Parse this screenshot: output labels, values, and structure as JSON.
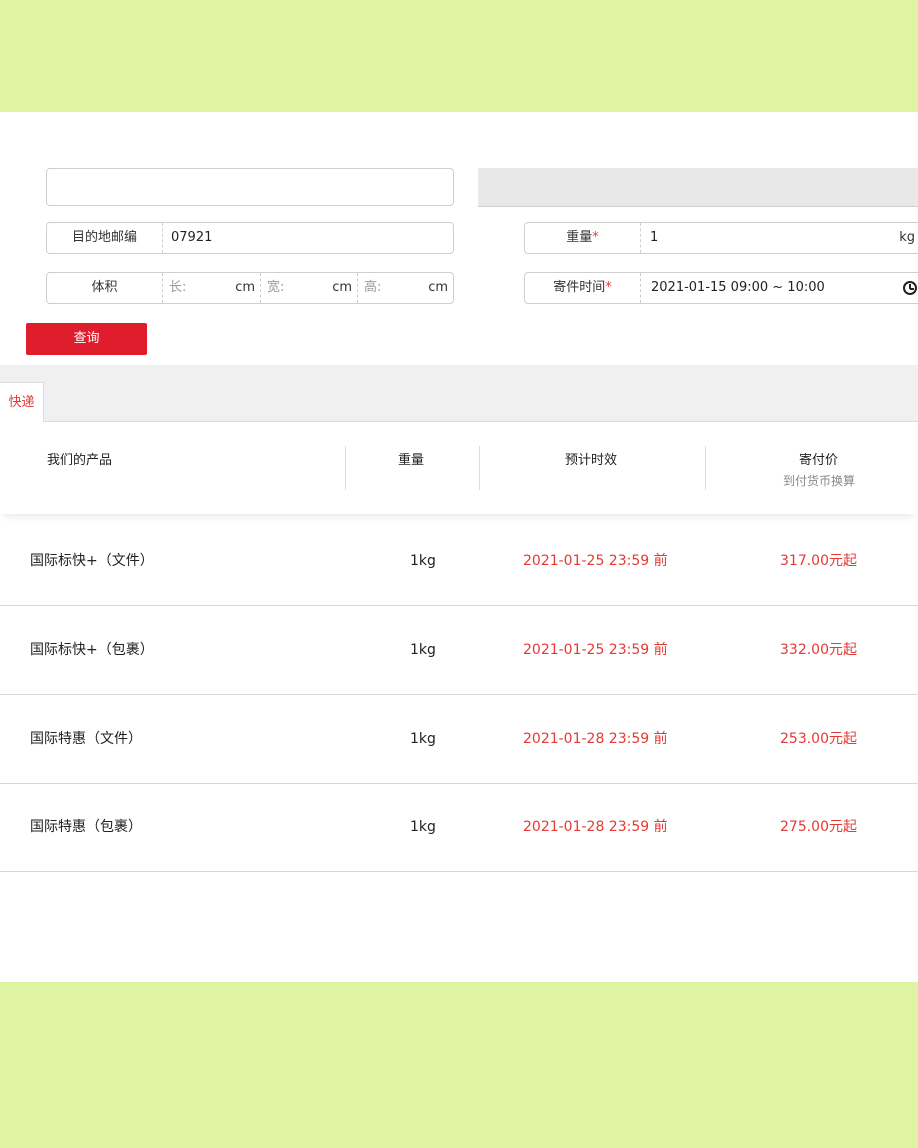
{
  "form": {
    "destination_zip_label": "目的地邮编",
    "destination_zip_value": "07921",
    "weight_label": "重量",
    "weight_value": "1",
    "weight_unit": "kg",
    "volume_label": "体积",
    "length_placeholder": "长:",
    "width_placeholder": "宽:",
    "height_placeholder": "高:",
    "dimension_unit": "cm",
    "ship_time_label": "寄件时间",
    "ship_time_value": "2021-01-15 09:00 ~ 10:00",
    "required_mark": "*",
    "query_button": "查询"
  },
  "tabs": [
    {
      "label": "快递",
      "active": true
    }
  ],
  "table": {
    "headers": {
      "product": "我们的产品",
      "weight": "重量",
      "eta": "预计时效",
      "price": "寄付价",
      "price_sub": "到付货币换算"
    },
    "rows": [
      {
        "product": "国际标快+（文件）",
        "weight": "1kg",
        "eta": "2021-01-25 23:59 前",
        "price": "317.00元起"
      },
      {
        "product": "国际标快+（包裹）",
        "weight": "1kg",
        "eta": "2021-01-25 23:59 前",
        "price": "332.00元起"
      },
      {
        "product": "国际特惠（文件）",
        "weight": "1kg",
        "eta": "2021-01-28 23:59 前",
        "price": "253.00元起"
      },
      {
        "product": "国际特惠（包裹）",
        "weight": "1kg",
        "eta": "2021-01-28 23:59 前",
        "price": "275.00元起"
      }
    ]
  },
  "colors": {
    "accent": "#e53935",
    "button": "#e01d2c",
    "outer_background": "#def4a3"
  },
  "icons": {
    "time_picker": "clock-icon"
  }
}
